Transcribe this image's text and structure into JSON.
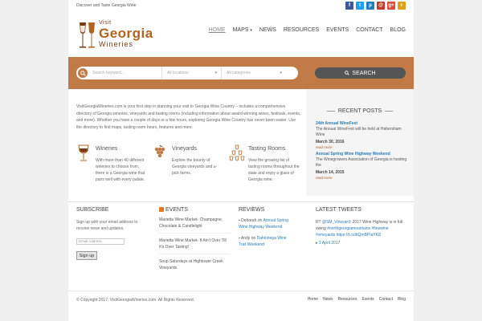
{
  "topbar": {
    "tagline": "Discover and Taste Georgia Wine",
    "social": [
      {
        "name": "facebook-icon",
        "glyph": "f",
        "color": "#3b5998"
      },
      {
        "name": "twitter-icon",
        "glyph": "t",
        "color": "#1da1f2"
      },
      {
        "name": "pinterest-icon",
        "glyph": "p",
        "color": "#1b7fc2"
      },
      {
        "name": "email-icon",
        "glyph": "@",
        "color": "#c0392b"
      },
      {
        "name": "googleplus-icon",
        "glyph": "g+",
        "color": "#dd4b39"
      },
      {
        "name": "rss-icon",
        "glyph": "r",
        "color": "#e0a01f"
      }
    ]
  },
  "logo": {
    "line1": "Visit",
    "line2": "Georgia",
    "line3": "Wineries"
  },
  "nav": {
    "items": [
      "HOME",
      "MAPS",
      "NEWS",
      "RESOURCES",
      "EVENTS",
      "CONTACT",
      "BLOG"
    ],
    "active": "HOME"
  },
  "search": {
    "keyword_placeholder": "Search keyword...",
    "location_placeholder": "All locations",
    "category_placeholder": "All categories",
    "button": "SEARCH"
  },
  "intro": "VisitGeorgiaWineries.com is your first step in planning your visit to Georgia Wine Country – includes a comprehensive directory of Georgia wineries, vineyards and tasting rooms (including information about award-winning wines, festivals, events, and more). Whether you have a couple of days or a few hours, exploring Georgia Wine Country has never been easier. Use the directory to find maps, tasting room hours, features and more.",
  "features": [
    {
      "title": "Wineries",
      "desc": "With more than 40 different wineries to choose from, there is a Georgia wine that pairs well with every palate."
    },
    {
      "title": "Vineyards",
      "desc": "Explore the bounty of Georgia vineyards and u-pick farms."
    },
    {
      "title": "Tasting Rooms",
      "desc": "View the growing list of tasting rooms throughout the state and enjoy a glass of Georgia wine."
    }
  ],
  "recent_posts": {
    "title": "RECENT POSTS",
    "items": [
      {
        "head": "24th Annual WineFest",
        "text": "The Annual WineFest will be held at Habersham Wine",
        "date": "March 30, 2016",
        "more": "read more"
      },
      {
        "head": "Annual Spring Wine Highway Weekend",
        "text": "The Winegrowers Association of Georgia is hosting the",
        "date": "March 14, 2015",
        "more": "read more"
      }
    ]
  },
  "subscribe": {
    "title": "SUBSCRIBE",
    "text": "Sign up with your email address to receive news and updates.",
    "placeholder": "Email Address",
    "button": "Sign up"
  },
  "events": {
    "title": "EVENTS",
    "items": [
      "Marietta Wine Market- Champagne, Chocolate & Candlelight",
      "Marietta Wine Market- It Ain't Over Till It's Over Tasting!",
      "Soup Saturdays at Hightower Creek Vineyards"
    ]
  },
  "reviews": {
    "title": "REVIEWS",
    "items": [
      {
        "author": "Deborah",
        "on": "on",
        "link": "Annual Spring Wine Highway Weekend"
      },
      {
        "author": "Andy",
        "on": "on",
        "link": "Dahlonega Wine Trail Weekend"
      }
    ]
  },
  "tweets": {
    "title": "LATEST TWEETS",
    "prefix": "RT",
    "handle": "@SM_Vineyard",
    "text": ": 2017 Wine Highway is in full swing",
    "tag1": "#northgeorgiamountains",
    "tag2": "#finewine",
    "tag3": "#vineyards",
    "link": "https://t.co/tiQmBPIaYK8",
    "date": "1 April 2017"
  },
  "footer": {
    "copyright": "© Copyright 2017, VisitGeorgiaWineries.com. All Rights Reserved.",
    "links": [
      "Home",
      "News",
      "Resources",
      "Events",
      "Contact",
      "Blog"
    ]
  },
  "colors": {
    "accent": "#c17a45",
    "link": "#2a7ab5",
    "logo": "#b3621f"
  }
}
